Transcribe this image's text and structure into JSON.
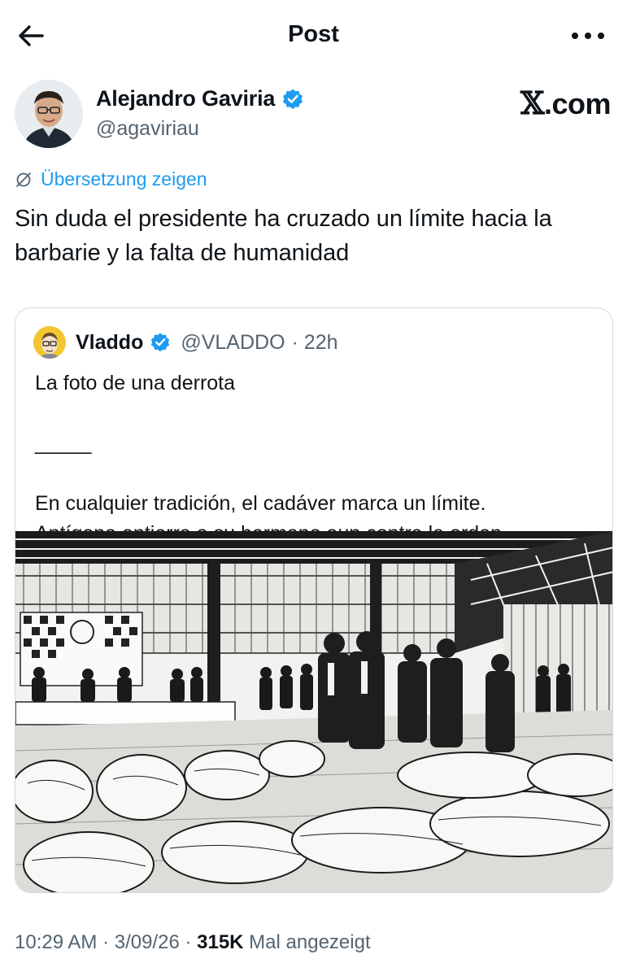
{
  "header": {
    "title": "Post",
    "back_icon": "arrow-left-icon",
    "more_icon": "more-horizontal-icon"
  },
  "author": {
    "name": "Alejandro Gaviria",
    "handle": "@agaviriau",
    "verified": true,
    "watermark": "X.com",
    "watermark_logo": "𝕏",
    "watermark_suffix": ".com"
  },
  "translate": {
    "label": "Übersetzung zeigen",
    "icon": "globe-slash-icon"
  },
  "tweet": {
    "text": "Sin duda el presidente ha cruzado un límite hacia la barbarie y la falta de humanidad"
  },
  "quote": {
    "name": "Vladdo",
    "handle": "@VLADDO",
    "time": "· 22h",
    "verified": true,
    "body": "La foto de una derrota\n\n_____\n\nEn cualquier tradición, el cadáver marca un límite.\nAntígona entierra a su hermano aun contra la orden…",
    "image_alt": "woodcut illustration of a hangar with body bags on the floor and officers walking among them"
  },
  "meta": {
    "time": "10:29 AM",
    "sep1": " · ",
    "date": "3/09/26",
    "sep2": " · ",
    "views": "315K",
    "views_label": " Mal angezeigt"
  },
  "colors": {
    "accent": "#1d9bf0",
    "text": "#0f1419",
    "muted": "#536471",
    "border": "#cfd9de"
  }
}
